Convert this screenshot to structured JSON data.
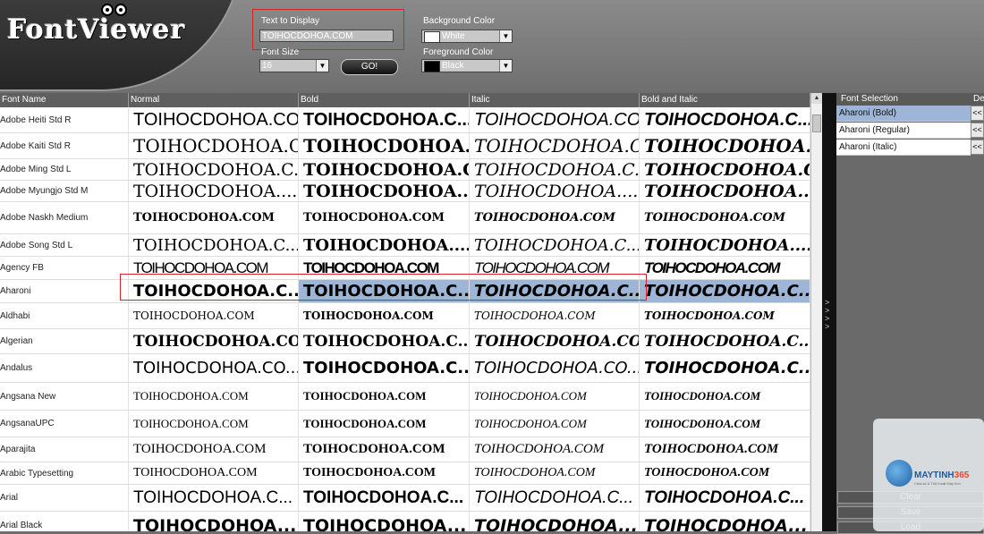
{
  "app": {
    "title": "FontViewer"
  },
  "controls": {
    "text_label": "Text to Display",
    "text_value": "TOIHOCDOHOA.COM",
    "font_size_label": "Font Size",
    "font_size_value": "16",
    "go_label": "GO!",
    "bg_label": "Background Color",
    "bg_value": "White",
    "bg_color": "#ffffff",
    "fg_label": "Foreground Color",
    "fg_value": "Black",
    "fg_color": "#000000"
  },
  "grid": {
    "headers": [
      "Font Name",
      "Normal",
      "Bold",
      "Italic",
      "Bold and Italic"
    ],
    "rows": [
      {
        "name": "Adobe Heiti Std R",
        "cells": [
          "TOIHOCDOHOA.CO...",
          "TOIHOCDOHOA.C...",
          "TOIHOCDOHOA.CO...",
          "TOIHOCDOHOA.C..."
        ]
      },
      {
        "name": "Adobe Kaiti Std R",
        "cells": [
          "TOIHOCDOHOA.C...",
          "TOIHOCDOHOA.C...",
          "TOIHOCDOHOA.C...",
          "TOIHOCDOHOA.C..."
        ]
      },
      {
        "name": "Adobe Ming Std L",
        "cells": [
          "TOIHOCDOHOA.C...",
          "TOIHOCDOHOA.C...",
          "TOIHOCDOHOA.C...",
          "TOIHOCDOHOA.C..."
        ]
      },
      {
        "name": "Adobe Myungjo Std M",
        "cells": [
          "TOIHOCDOHOA....",
          "TOIHOCDOHOA....",
          "TOIHOCDOHOA....",
          "TOIHOCDOHOA...."
        ]
      },
      {
        "name": "Adobe Naskh Medium",
        "cells": [
          "TOIHOCDOHOA.COM",
          "TOIHOCDOHOA.COM",
          "TOIHOCDOHOA.COM",
          "TOIHOCDOHOA.COM"
        ]
      },
      {
        "name": "Adobe Song Std L",
        "cells": [
          "TOIHOCDOHOA.C...",
          "TOIHOCDOHOA....",
          "TOIHOCDOHOA.C...",
          "TOIHOCDOHOA...."
        ]
      },
      {
        "name": "Agency FB",
        "cells": [
          "TOIHOCDOHOA.COM",
          "TOIHOCDOHOA.COM",
          "TOIHOCDOHOA.COM",
          "TOIHOCDOHOA.COM"
        ]
      },
      {
        "name": "Aharoni",
        "selected": true,
        "cells": [
          "TOIHOCDOHOA.C...",
          "TOIHOCDOHOA.C...",
          "TOIHOCDOHOA.C...",
          "TOIHOCDOHOA.C..."
        ]
      },
      {
        "name": "Aldhabi",
        "cells": [
          "TOIHOCDOHOA.COM",
          "TOIHOCDOHOA.COM",
          "TOIHOCDOHOA.COM",
          "TOIHOCDOHOA.COM"
        ]
      },
      {
        "name": "Algerian",
        "cells": [
          "TOIHOCDOHOA.COM",
          "TOIHOCDOHOA.C...",
          "TOIHOCDOHOA.COM",
          "TOIHOCDOHOA.C..."
        ]
      },
      {
        "name": "Andalus",
        "cells": [
          "TOIHOCDOHOA.CO...",
          "TOIHOCDOHOA.C...",
          "TOIHOCDOHOA.CO...",
          "TOIHOCDOHOA.C..."
        ]
      },
      {
        "name": "Angsana New",
        "cells": [
          "TOIHOCDOHOA.COM",
          "TOIHOCDOHOA.COM",
          "TOIHOCDOHOA.COM",
          "TOIHOCDOHOA.COM"
        ]
      },
      {
        "name": "AngsanaUPC",
        "cells": [
          "TOIHOCDOHOA.COM",
          "TOIHOCDOHOA.COM",
          "TOIHOCDOHOA.COM",
          "TOIHOCDOHOA.COM"
        ]
      },
      {
        "name": "Aparajita",
        "cells": [
          "TOIHOCDOHOA.COM",
          "TOIHOCDOHOA.COM",
          "TOIHOCDOHOA.COM",
          "TOIHOCDOHOA.COM"
        ]
      },
      {
        "name": "Arabic Typesetting",
        "cells": [
          "TOIHOCDOHOA.COM",
          "TOIHOCDOHOA.COM",
          "TOIHOCDOHOA.COM",
          "TOIHOCDOHOA.COM"
        ]
      },
      {
        "name": "Arial",
        "cells": [
          "TOIHOCDOHOA.C...",
          "TOIHOCDOHOA.C...",
          "TOIHOCDOHOA.C...",
          "TOIHOCDOHOA.C..."
        ]
      },
      {
        "name": "Arial Black",
        "cells": [
          "TOIHOCDOHOA...",
          "TOIHOCDOHOA...",
          "TOIHOCDOHOA...",
          "TOIHOCDOHOA..."
        ]
      }
    ]
  },
  "selection_panel": {
    "header": "Font Selection",
    "header2": "De",
    "items": [
      {
        "label": "Aharoni (Bold)",
        "selected": true,
        "btn": "<<"
      },
      {
        "label": "Aharoni (Regular)",
        "selected": false,
        "btn": "<<"
      },
      {
        "label": "Aharoni (Italic)",
        "selected": false,
        "btn": "<<"
      }
    ],
    "buttons": [
      "Clear",
      "Save",
      "Load"
    ]
  },
  "watermark": {
    "brand_a": "MAYTINH",
    "brand_b": "365",
    "tagline": "Chia sẻ & Thủ thuật Máy tính"
  }
}
